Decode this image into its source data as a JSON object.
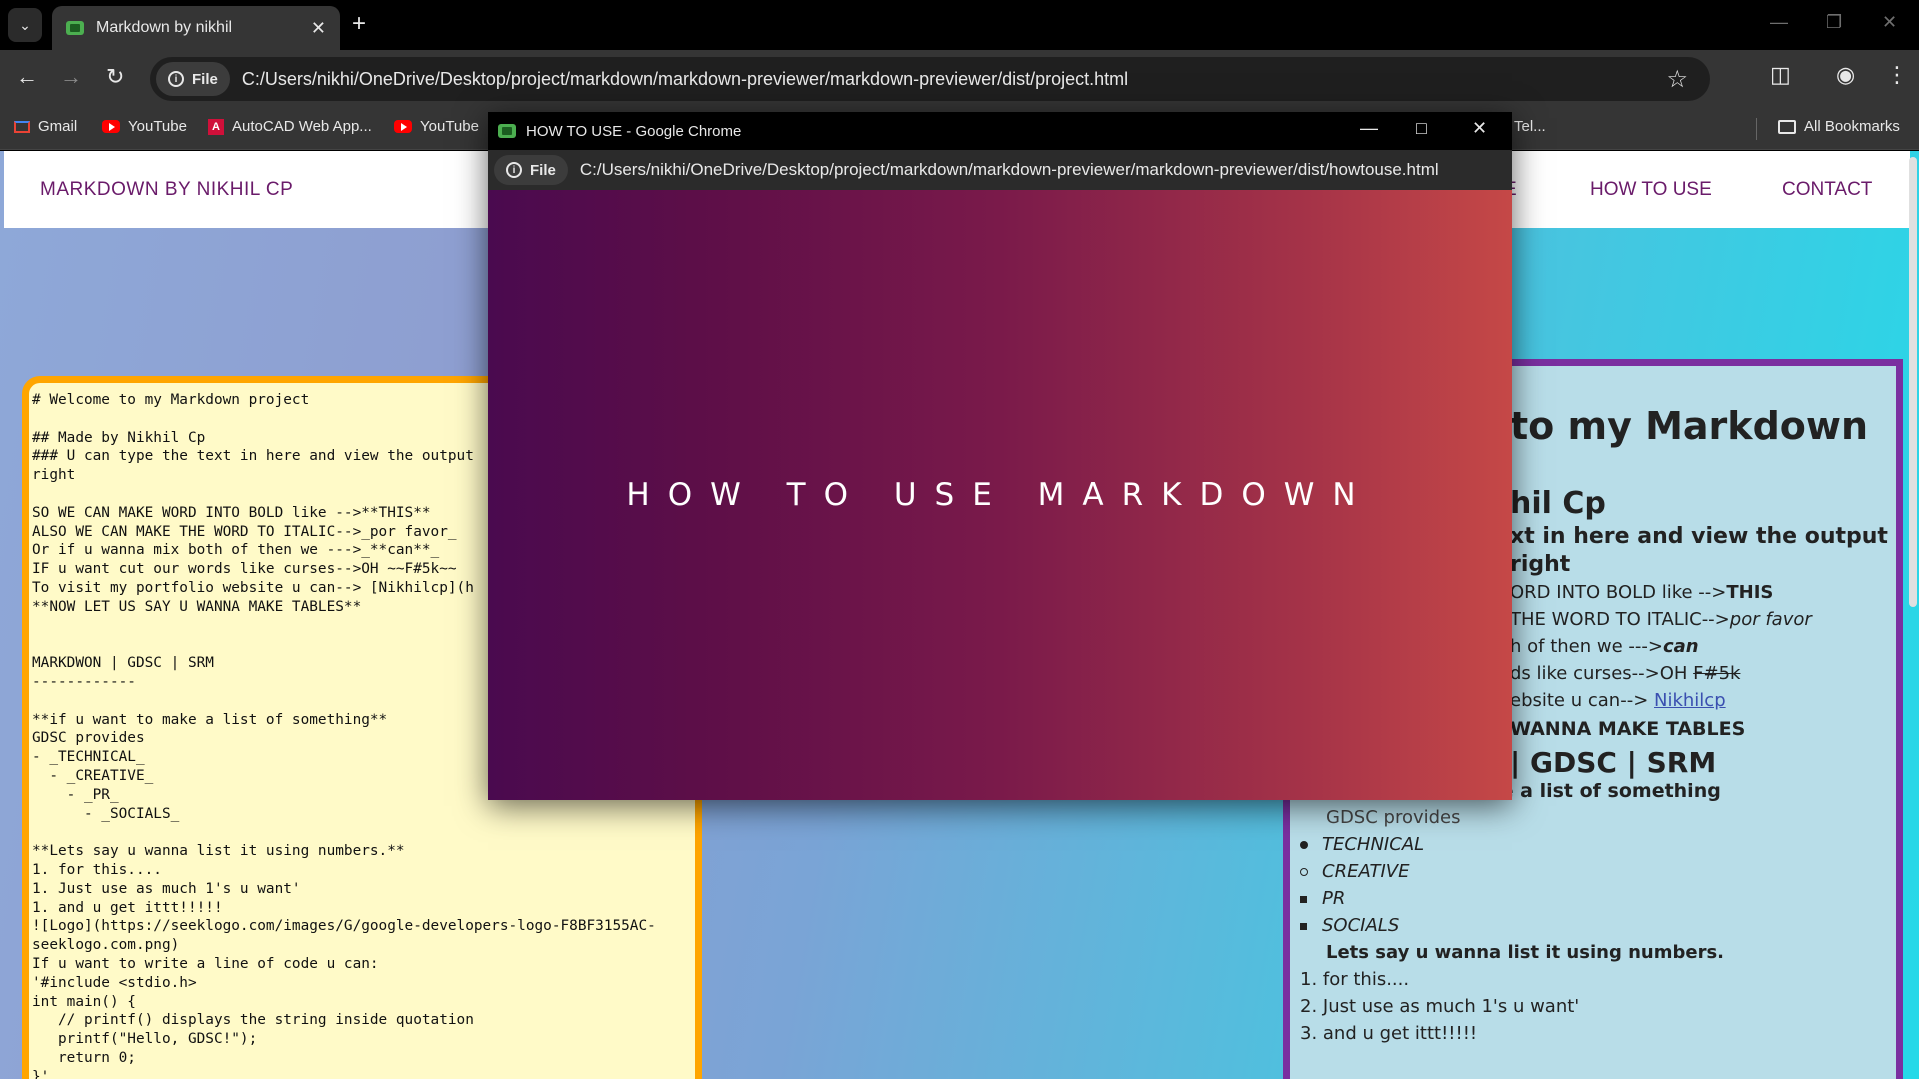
{
  "browser": {
    "tab_title": "Markdown by nikhil",
    "file_chip": "File",
    "url": "C:/Users/nikhi/OneDrive/Desktop/project/markdown/markdown-previewer/markdown-previewer/dist/project.html",
    "bookmarks": [
      "Gmail",
      "YouTube",
      "AutoCAD Web App...",
      "YouTube",
      "Tel..."
    ],
    "all_bookmarks": "All Bookmarks"
  },
  "site": {
    "brand": "MARKDOWN BY NIKHIL CP",
    "nav_partial": "E",
    "nav_how": "HOW TO USE",
    "nav_contact": "CONTACT"
  },
  "editor": {
    "text": "# Welcome to my Markdown project\n\n## Made by Nikhil Cp\n### U can type the text in here and view the output\nright\n\nSO WE CAN MAKE WORD INTO BOLD like -->**THIS**\nALSO WE CAN MAKE THE WORD TO ITALIC-->_por favor_\nOr if u wanna mix both of then we --->_**can**_\nIF u want cut our words like curses-->OH ~~F#5k~~\nTo visit my portfolio website u can--> [Nikhilcp](h\n**NOW LET US SAY U WANNA MAKE TABLES**\n\n\nMARKDWON | GDSC | SRM\n------------\n\n**if u want to make a list of something**\nGDSC provides\n- _TECHNICAL_\n  - _CREATIVE_\n    - _PR_\n      - _SOCIALS_\n\n**Lets say u wanna list it using numbers.**\n1. for this....\n1. Just use as much 1's u want'\n1. and u get ittt!!!!!\n![Logo](https://seeklogo.com/images/G/google-developers-logo-F8BF3155AC-\nseeklogo.com.png)\nIf u want to write a line of code u can:\n'#include <stdio.h>\nint main() {\n   // printf() displays the string inside quotation\n   printf(\"Hello, GDSC!\");\n   return 0;\n}'"
  },
  "preview": {
    "h1": "to my Markdown",
    "h2": "hil Cp",
    "h3_line1": "xt in here and view the output",
    "h3_line2": "right",
    "bold_prefix": "ORD INTO BOLD like -->",
    "bold_word": "THIS",
    "italic_prefix": "THE WORD TO ITALIC-->",
    "italic_word": "por favor",
    "mix_prefix": "h of then we --->",
    "mix_word": "can",
    "curse_prefix": "ds like curses-->OH ",
    "curse_word": "F#5k",
    "link_prefix": "ebsite u can--> ",
    "link_word": "Nikhilcp",
    "tables_line": "WANNA MAKE TABLES",
    "table_header": "| GDSC | SRM",
    "list_heading": "if u want to make a list of something",
    "gdsc": "GDSC provides",
    "list_items": [
      "TECHNICAL",
      "CREATIVE",
      "PR",
      "SOCIALS"
    ],
    "numbers_heading": "Lets say u wanna list it using numbers.",
    "ordered": [
      "1. for this....",
      "2. Just use as much 1's u want'",
      "3. and u get ittt!!!!!"
    ]
  },
  "popup": {
    "title": "HOW TO USE - Google Chrome",
    "file_chip": "File",
    "url": "C:/Users/nikhi/OneDrive/Desktop/project/markdown/markdown-previewer/markdown-previewer/dist/howtouse.html",
    "hero": "HOW TO USE MARKDOWN"
  },
  "colors": {
    "brand_purple": "#6a1b6a",
    "editor_border": "#ffa500",
    "editor_bg": "#fffac8",
    "preview_border": "#7a2fa0"
  }
}
